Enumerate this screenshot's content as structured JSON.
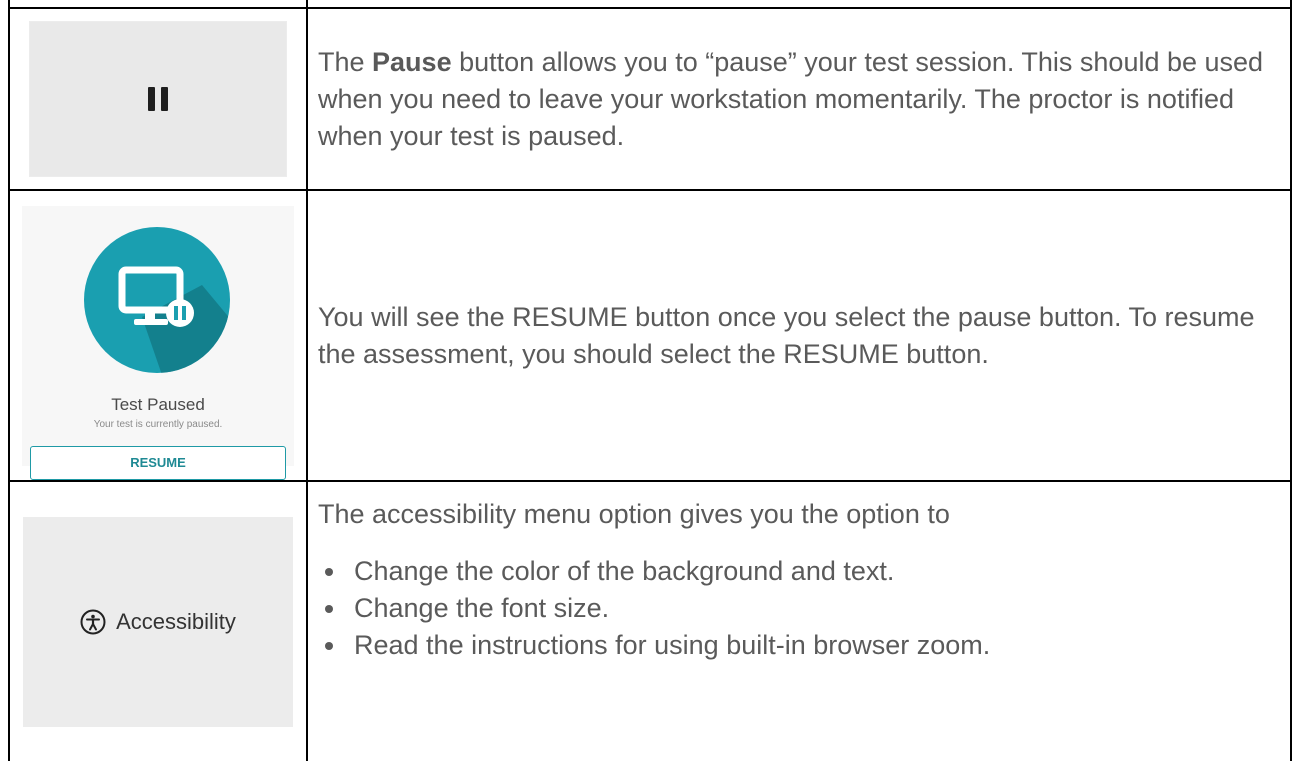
{
  "rows": {
    "pause": {
      "icon": "pause-icon",
      "text_prefix": "The ",
      "text_bold": "Pause",
      "text_rest": " button allows you to “pause” your test session. This should be used when you need to leave your workstation momentarily. The proctor is notified when your test is paused."
    },
    "resume": {
      "card_title": "Test Paused",
      "card_subtitle": "Your test is currently paused.",
      "button_label": "RESUME",
      "icon": "monitor-pause-icon",
      "text": "You will see the RESUME button once you select the pause button. To resume the assessment, you should select the RESUME button."
    },
    "accessibility": {
      "icon": "accessibility-icon",
      "label": "Accessibility",
      "intro": "The accessibility menu option gives you the option to",
      "bullets": [
        "Change the color of the background and text.",
        "Change the font size.",
        "Read the instructions for using built-in browser zoom."
      ]
    }
  },
  "colors": {
    "teal": "#1a9fb0",
    "teal_shadow": "#137a87",
    "border": "#000000",
    "text": "#595959"
  }
}
